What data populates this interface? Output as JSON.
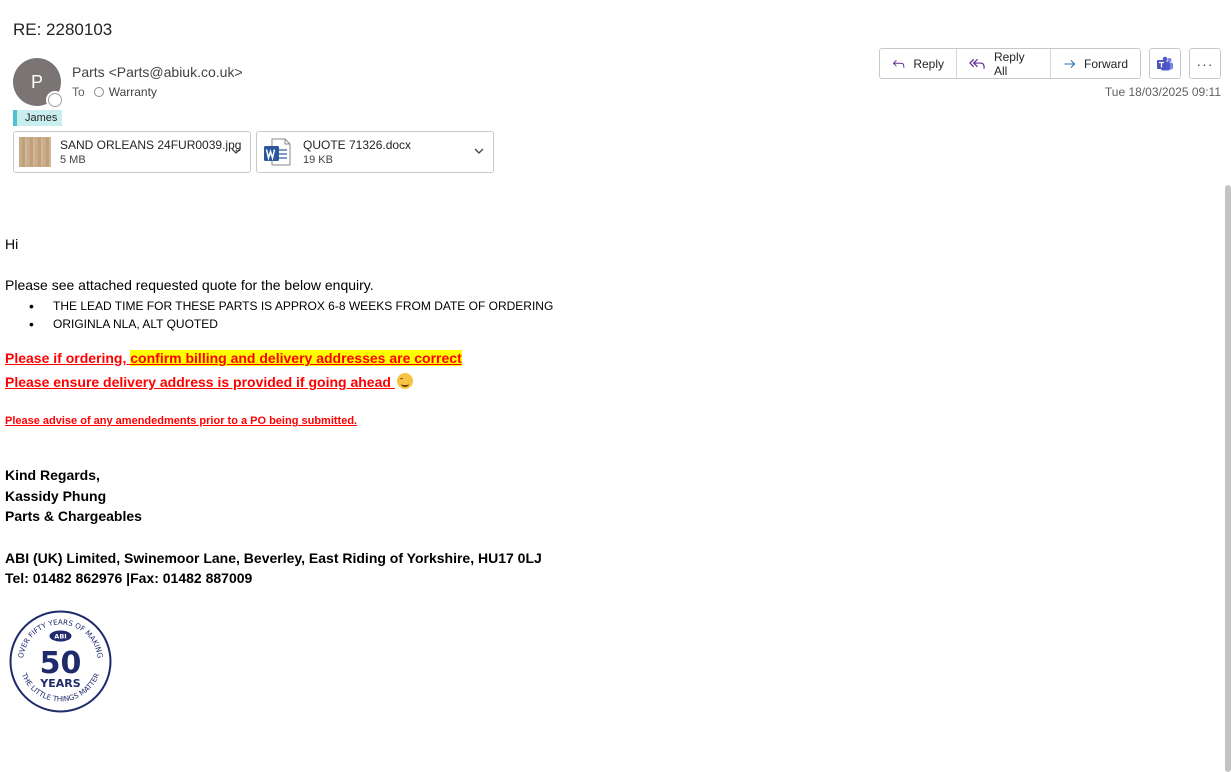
{
  "subject": "RE: 2280103",
  "sender": {
    "initial": "P",
    "display": "Parts <Parts@abiuk.co.uk>"
  },
  "recipients": {
    "to_label": "To",
    "to": "Warranty"
  },
  "category": "James",
  "datetime": "Tue 18/03/2025 09:11",
  "actions": {
    "reply": "Reply",
    "reply_all": "Reply All",
    "forward": "Forward",
    "more": "···"
  },
  "attachments": [
    {
      "name": "SAND ORLEANS 24FUR0039.jpg",
      "size": "5 MB",
      "icon": "image-thumbnail"
    },
    {
      "name": "QUOTE 71326.docx",
      "size": "19 KB",
      "icon": "word-icon"
    }
  ],
  "body": {
    "greeting": "Hi",
    "intro": "Please see attached requested quote for the below enquiry.",
    "bullets": [
      "THE LEAD TIME FOR THESE PARTS IS APPROX 6-8 WEEKS FROM DATE OF ORDERING",
      "ORIGINLA NLA, ALT QUOTED"
    ],
    "notice1_prefix": "Please if ordering, ",
    "notice1_highlight": "confirm billing and delivery addresses are correct",
    "notice2": "Please ensure delivery address is provided if going ahead ",
    "notice3": "Please advise of any amendedments prior to a PO being submitted."
  },
  "signature": {
    "closing": "Kind Regards,",
    "name": "Kassidy Phung",
    "department": "Parts & Chargeables",
    "address": "ABI (UK) Limited, Swinemoor Lane, Beverley, East Riding of Yorkshire, HU17 0LJ",
    "tel": "Tel: 01482 862976 |Fax: 01482 887009"
  },
  "logo": {
    "top_text": "OVER FIFTY YEARS OF MAKING",
    "bottom_text": "THE LITTLE THINGS MATTER",
    "brand": "ABI",
    "number": "50",
    "years": "YEARS"
  },
  "colors": {
    "avatar": "#7a7574",
    "category": "#c9eef0",
    "category_bar": "#4cc3cf",
    "notice_red": "#ff0000",
    "highlight": "#ffff00",
    "logo_blue": "#1f2a6b"
  }
}
